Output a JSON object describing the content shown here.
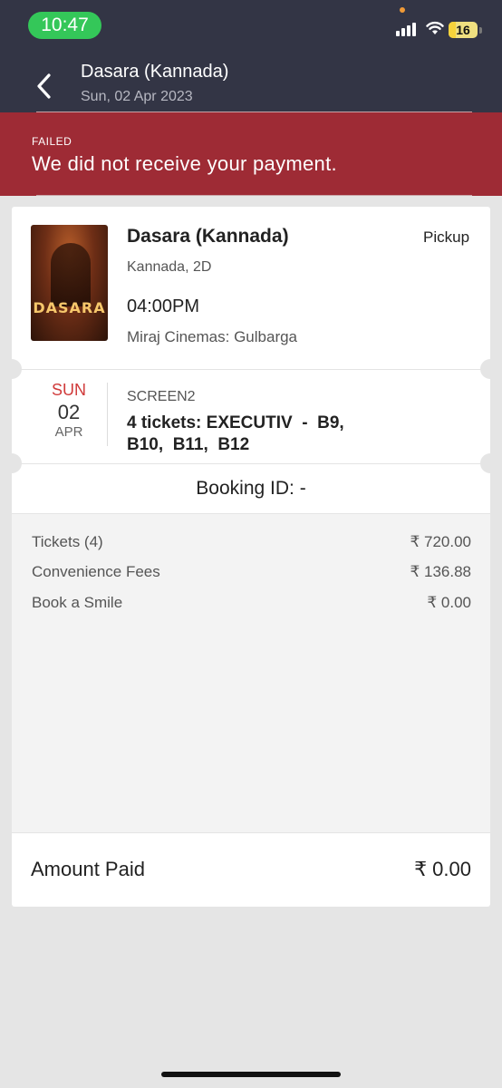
{
  "status_bar": {
    "time": "10:47",
    "battery": "16",
    "colors": {
      "time_pill": "#34c759",
      "dot": "#f09a37"
    }
  },
  "header": {
    "back_icon": "chevron-left-icon",
    "title": "Dasara (Kannada)",
    "subtitle": "Sun, 02 Apr 2023",
    "background": "#333545"
  },
  "alert": {
    "label": "FAILED",
    "message": "We did not receive your payment.",
    "background": "#9e2b35"
  },
  "movie": {
    "poster_text": "DASARA",
    "name": "Dasara (Kannada)",
    "pickup_label": "Pickup",
    "language_format": "Kannada, 2D",
    "showtime": "04:00PM",
    "cinema": "Miraj Cinemas: Gulbarga"
  },
  "show": {
    "day": "SUN",
    "date": "02",
    "month": "APR",
    "screen": "SCREEN2",
    "tickets_line": "4 tickets: EXECUTIV  -  B9,\nB10,  B11,  B12"
  },
  "booking": {
    "id_text": "Booking ID: -"
  },
  "summary": {
    "rows": [
      {
        "label": "Tickets (4)",
        "value": "₹ 720.00"
      },
      {
        "label": "Convenience Fees",
        "value": "₹ 136.88"
      },
      {
        "label": "Book a Smile",
        "value": "₹ 0.00"
      }
    ],
    "total_label": "Amount Paid",
    "total_value": "₹ 0.00"
  }
}
